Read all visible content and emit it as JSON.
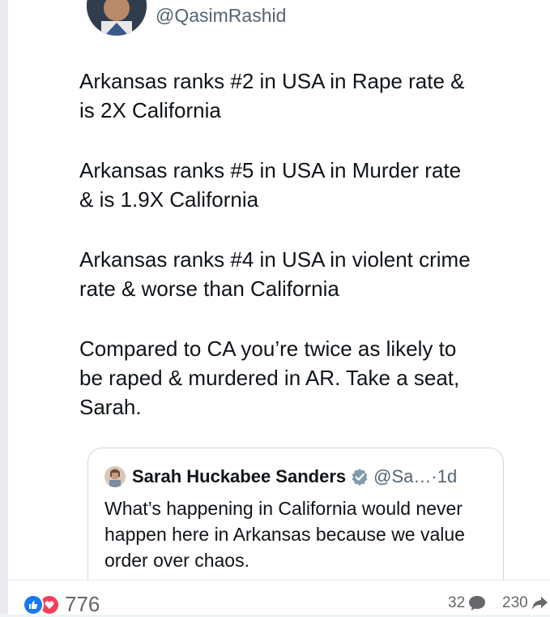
{
  "tweet": {
    "handle": "@QasimRashid",
    "paragraphs": [
      "Arkansas ranks #2 in USA in Rape rate &\nis 2X California",
      "Arkansas ranks #5 in USA in Murder rate\n& is 1.9X California",
      "Arkansas ranks #4 in USA in violent crime\nrate & worse than California",
      "Compared to CA you’re twice as likely to\nbe raped & murdered in AR. Take a seat,\nSarah."
    ]
  },
  "quote": {
    "name": "Sarah Huckabee Sanders",
    "handle_time": "@Sa…·1d",
    "text": "What’s happening in California would never happen here in Arkansas because we value order over chaos."
  },
  "footer": {
    "reactions_count": "776",
    "comments_count": "32",
    "shares_count": "230"
  },
  "colors": {
    "like": "#1877f2",
    "love": "#f33e58",
    "verified": "#829aab"
  }
}
